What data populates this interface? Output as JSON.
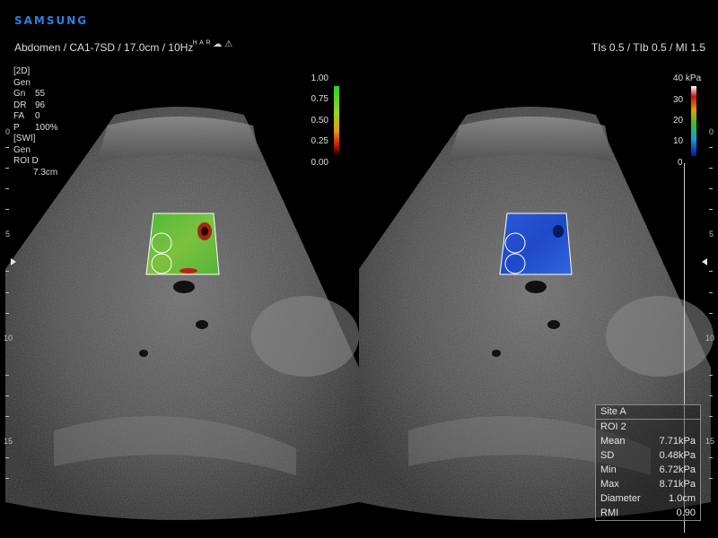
{
  "brand": "SAMSUNG",
  "header": {
    "left": "Abdomen / CA1-7SD / 17.0cm / 10Hz",
    "right": "TIs  0.5 / TIb  0.5 / MI    1.5"
  },
  "params": {
    "mode_2d": "[2D]",
    "gen_1": "Gen",
    "rows": [
      {
        "k": "Gn",
        "v": "55"
      },
      {
        "k": "DR",
        "v": "96"
      },
      {
        "k": "FA",
        "v": "0"
      },
      {
        "k": "P",
        "v": "100%"
      }
    ],
    "mode_swi": "[SWI]",
    "gen_2": "Gen",
    "roi_d_label": "ROI D",
    "roi_d_value": "7.3cm"
  },
  "quality_scale": {
    "labels": [
      "1.00",
      "0.75",
      "0.50",
      "0.25",
      "0.00"
    ]
  },
  "kpa_scale": {
    "top_label": "40 kPa",
    "labels": [
      "30",
      "20",
      "10",
      "0"
    ]
  },
  "depth_labels": {
    "left": [
      "0",
      "5",
      "10",
      "15"
    ],
    "right": [
      "0",
      "5",
      "10",
      "15"
    ]
  },
  "results": {
    "site": "Site A",
    "roi": "ROI 2",
    "rows": [
      {
        "label": "Mean",
        "value": "7.71kPa"
      },
      {
        "label": "SD",
        "value": "0.48kPa"
      },
      {
        "label": "Min",
        "value": "6.72kPa"
      },
      {
        "label": "Max",
        "value": "8.71kPa"
      },
      {
        "label": "Diameter",
        "value": "1.0cm"
      },
      {
        "label": "RMI",
        "value": "0.90"
      }
    ]
  },
  "colors": {
    "brand": "#2f7fe0",
    "quality_high": "#3ad43a",
    "stiffness_low": "#1a3ad8"
  }
}
